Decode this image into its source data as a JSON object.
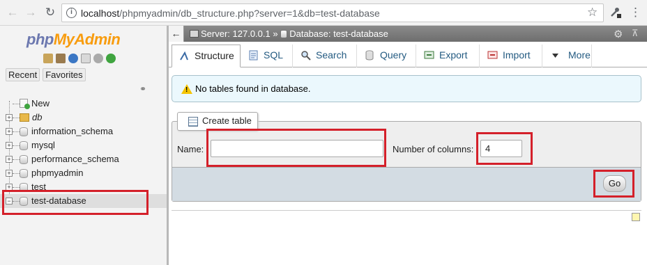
{
  "browser": {
    "url_host": "localhost",
    "url_path": "/phpmyadmin/db_structure.php?server=1&db=test-database"
  },
  "logo": {
    "php": "php",
    "my": "My",
    "admin": "Admin"
  },
  "sidebar": {
    "tabs": [
      "Recent",
      "Favorites"
    ],
    "tree": [
      {
        "label": "New",
        "kind": "new"
      },
      {
        "label": "db",
        "kind": "folder"
      },
      {
        "label": "information_schema",
        "kind": "db"
      },
      {
        "label": "mysql",
        "kind": "db"
      },
      {
        "label": "performance_schema",
        "kind": "db"
      },
      {
        "label": "phpmyadmin",
        "kind": "db"
      },
      {
        "label": "test",
        "kind": "db"
      },
      {
        "label": "test-database",
        "kind": "db",
        "selected": true
      }
    ]
  },
  "header": {
    "server": "Server: 127.0.0.1",
    "separator": "»",
    "database": "Database: test-database"
  },
  "menu": {
    "tabs": [
      {
        "label": "Structure",
        "active": true
      },
      {
        "label": "SQL"
      },
      {
        "label": "Search"
      },
      {
        "label": "Query"
      },
      {
        "label": "Export"
      },
      {
        "label": "Import"
      },
      {
        "label": "More"
      }
    ]
  },
  "notice": {
    "text": "No tables found in database."
  },
  "create_table": {
    "legend": "Create table",
    "name_label": "Name:",
    "name_value": "",
    "columns_label": "Number of columns:",
    "columns_value": "4",
    "go_label": "Go"
  },
  "colors": {
    "highlight": "#d4202a",
    "link": "#235a81",
    "header_bg": "#777777"
  }
}
